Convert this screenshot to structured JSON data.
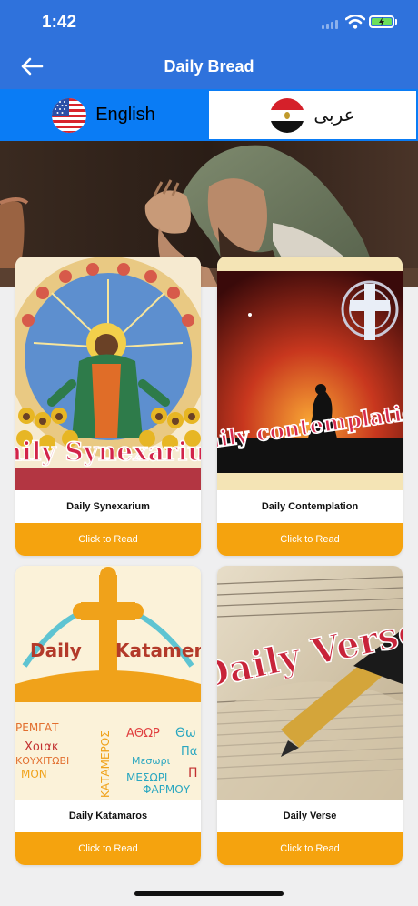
{
  "status_bar": {
    "time": "1:42"
  },
  "header": {
    "title": "Daily Bread",
    "back_icon": "arrow-left-icon"
  },
  "languages": [
    {
      "label": "English",
      "flag": "us-flag-icon",
      "active": true
    },
    {
      "label": "عربى",
      "flag": "egypt-flag-icon",
      "active": false
    }
  ],
  "cards": [
    {
      "title": "Daily Synexarium",
      "button": "Click to Read",
      "art_text": "Daily Synexarium"
    },
    {
      "title": "Daily Contemplation",
      "button": "Click to Read",
      "art_text": "Daily contemplation"
    },
    {
      "title": "Daily Katamaros",
      "button": "Click to Read",
      "art_text_1": "Daily",
      "art_text_2": "Katamer",
      "art_words": [
        "ΡΕΜΓΑΤ",
        "Χοιακ",
        "ΚΟΥΧΙΤΩΒΙ",
        "ΜΟΝ",
        "ΚΑΤΑΜΕΡΟΣ",
        "ΑΘΩΡ",
        "Μεσωρι",
        "ΜΕΣΩΡΙ",
        "ΦΑΡΜΟΥ",
        "Θω",
        "Πα",
        "Π"
      ]
    },
    {
      "title": "Daily Verse",
      "button": "Click to Read",
      "art_text": "Daily Verse"
    }
  ],
  "colors": {
    "header": "#2f72dc",
    "active_tab": "#0a7cf5",
    "button": "#f5a30e"
  }
}
